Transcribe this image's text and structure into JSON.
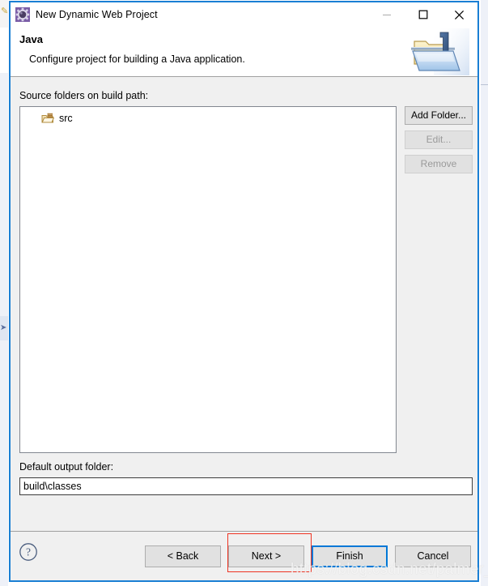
{
  "window": {
    "title": "New Dynamic Web Project",
    "icon": "eclipse-wizard-gear-icon",
    "controls": {
      "minimize": "minimize-icon",
      "maximize": "maximize-icon",
      "close": "close-icon"
    }
  },
  "header": {
    "title": "Java",
    "description": "Configure project for building a Java application.",
    "icon": "java-folder-banner-icon"
  },
  "body": {
    "source_label": "Source folders on build path:",
    "tree_items": [
      {
        "label": "src",
        "icon": "source-folder-icon"
      }
    ],
    "side_buttons": [
      {
        "label": "Add Folder...",
        "enabled": true
      },
      {
        "label": "Edit...",
        "enabled": false
      },
      {
        "label": "Remove",
        "enabled": false
      }
    ],
    "output_label": "Default output folder:",
    "output_value": "build\\classes",
    "output_placeholder": ""
  },
  "footer": {
    "help_icon": "help-question-icon",
    "buttons": [
      {
        "label": "< Back",
        "name": "back-button",
        "default": false
      },
      {
        "label": "Next >",
        "name": "next-button",
        "default": false
      },
      {
        "label": "Finish",
        "name": "finish-button",
        "default": true
      },
      {
        "label": "Cancel",
        "name": "cancel-button",
        "default": false
      }
    ]
  },
  "annotation": {
    "target": "next-button",
    "color": "#ee3322"
  },
  "watermark": {
    "text": "https://blog.csdn.net/palmer_kai"
  },
  "colors": {
    "dialog_border": "#1a7fd4",
    "default_button_border": "#0078d7",
    "body_background": "#f0f0f0",
    "annotation_red": "#ee3322"
  }
}
